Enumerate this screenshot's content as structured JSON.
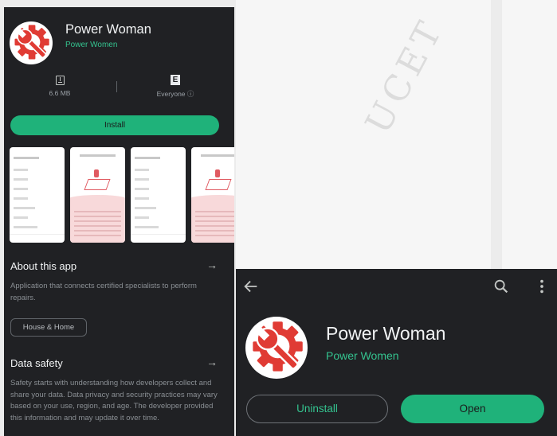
{
  "colors": {
    "accent": "#1fb27a",
    "developer": "#34c38f",
    "icon_red": "#e03b34",
    "background": "#202124"
  },
  "left_screen": {
    "app_title": "Power Woman",
    "developer": "Power Women",
    "stats": [
      {
        "icon": "download-icon",
        "label": "6.6 MB"
      },
      {
        "icon": "content-rating-icon",
        "glyph": "E",
        "label": "Everyone ⓘ"
      }
    ],
    "install_label": "Install",
    "about": {
      "heading": "About this app",
      "description": "Application that connects certified specialists to perform repairs.",
      "category_chip": "House & Home"
    },
    "data_safety": {
      "heading": "Data safety",
      "description": "Safety starts with understanding how developers collect and share your data. Data privacy and security practices may vary based on your use, region, and age. The developer provided this information and may update it over time."
    }
  },
  "right_screen": {
    "app_title": "Power Woman",
    "developer": "Power Women",
    "uninstall_label": "Uninstall",
    "open_label": "Open",
    "icons": [
      "back-arrow-icon",
      "search-icon",
      "more-vert-icon"
    ]
  }
}
